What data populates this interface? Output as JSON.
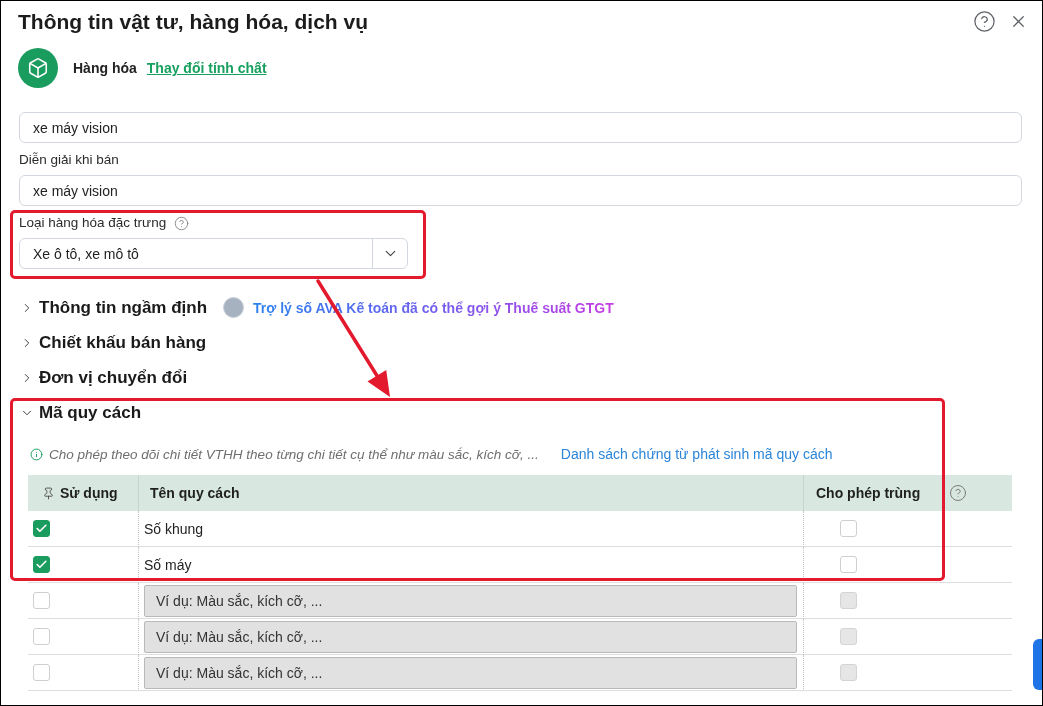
{
  "dialog": {
    "title": "Thông tin vật tư, hàng hóa, dịch vụ"
  },
  "item_type": {
    "name": "Hàng hóa",
    "change_link": "Thay đổi tính chất"
  },
  "fields": [
    {
      "kind": "text",
      "value": "xe máy vision"
    },
    {
      "kind": "text",
      "label": "Diễn giải khi bán",
      "value": "xe máy vision"
    },
    {
      "kind": "select",
      "label": "Loại hàng hóa đặc trưng",
      "value": "Xe ô tô, xe mô tô",
      "highlighted": true
    }
  ],
  "sections": [
    {
      "title": "Thông tin ngầm định",
      "expanded": false,
      "assistant_note": "Trợ lý số AVA Kế toán đã có thể gợi ý Thuế suất GTGT"
    },
    {
      "title": "Chiết khấu bán hàng",
      "expanded": false
    },
    {
      "title": "Đơn vị chuyển đổi",
      "expanded": false
    },
    {
      "title": "Mã quy cách",
      "expanded": true,
      "highlighted": true
    }
  ],
  "spec_codes": {
    "note": "Cho phép theo dõi chi tiết VTHH theo từng chi tiết cụ thể như màu sắc, kích cỡ, ...",
    "link": "Danh sách chứng từ phát sinh mã quy cách",
    "columns": [
      "Sử dụng",
      "Tên quy cách",
      "Cho phép trùng"
    ],
    "rows": [
      {
        "kind": "entry",
        "used": true,
        "name": "Số khung",
        "allow_duplicate": false,
        "duplicate_disabled": false
      },
      {
        "kind": "entry",
        "used": true,
        "name": "Số máy",
        "allow_duplicate": false,
        "duplicate_disabled": false
      },
      {
        "kind": "blank",
        "used": false,
        "placeholder": "Ví dụ: Màu sắc, kích cỡ, ...",
        "allow_duplicate": false,
        "duplicate_disabled": true
      },
      {
        "kind": "blank",
        "used": false,
        "placeholder": "Ví dụ: Màu sắc, kích cỡ, ...",
        "allow_duplicate": false,
        "duplicate_disabled": true
      },
      {
        "kind": "blank",
        "used": false,
        "placeholder": "Ví dụ: Màu sắc, kích cỡ, ...",
        "allow_duplicate": false,
        "duplicate_disabled": true
      }
    ]
  }
}
